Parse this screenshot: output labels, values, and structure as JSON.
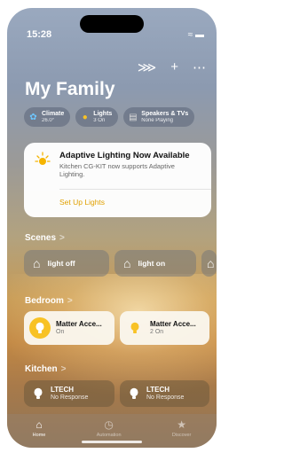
{
  "status_bar": {
    "time": "15:28",
    "icons": "wifi battery"
  },
  "toolbar": {
    "voice_icon": "waveform-icon",
    "add_icon": "plus-icon",
    "more_icon": "more-icon"
  },
  "home": {
    "title": "My Family"
  },
  "chips": [
    {
      "title": "Climate",
      "subtitle": "26.0°",
      "icon": "fan-icon"
    },
    {
      "title": "Lights",
      "subtitle": "3 On",
      "icon": "bulb-icon"
    },
    {
      "title": "Speakers & TVs",
      "subtitle": "None Playing",
      "icon": "tv-icon"
    }
  ],
  "banner": {
    "heading": "Adaptive Lighting Now Available",
    "body": "Kitchen CG-KIT now supports Adaptive Lighting.",
    "action": "Set Up Lights"
  },
  "sections": {
    "scenes": "Scenes",
    "bedroom": "Bedroom",
    "kitchen": "Kitchen",
    "chevron": ">"
  },
  "scenes": [
    {
      "label": "light off"
    },
    {
      "label": "light on"
    }
  ],
  "bedroom": [
    {
      "name": "Matter Acce...",
      "status": "On"
    },
    {
      "name": "Matter Acce...",
      "status": "2 On"
    }
  ],
  "kitchen": [
    {
      "name": "LTECH",
      "status": "No Response"
    },
    {
      "name": "LTECH",
      "status": "No Response"
    }
  ],
  "tabs": [
    {
      "label": "Home",
      "active": true
    },
    {
      "label": "Automation",
      "active": false
    },
    {
      "label": "Discover",
      "active": false
    }
  ],
  "colors": {
    "accent": "#e0a000",
    "bulb": "#f8c225"
  }
}
